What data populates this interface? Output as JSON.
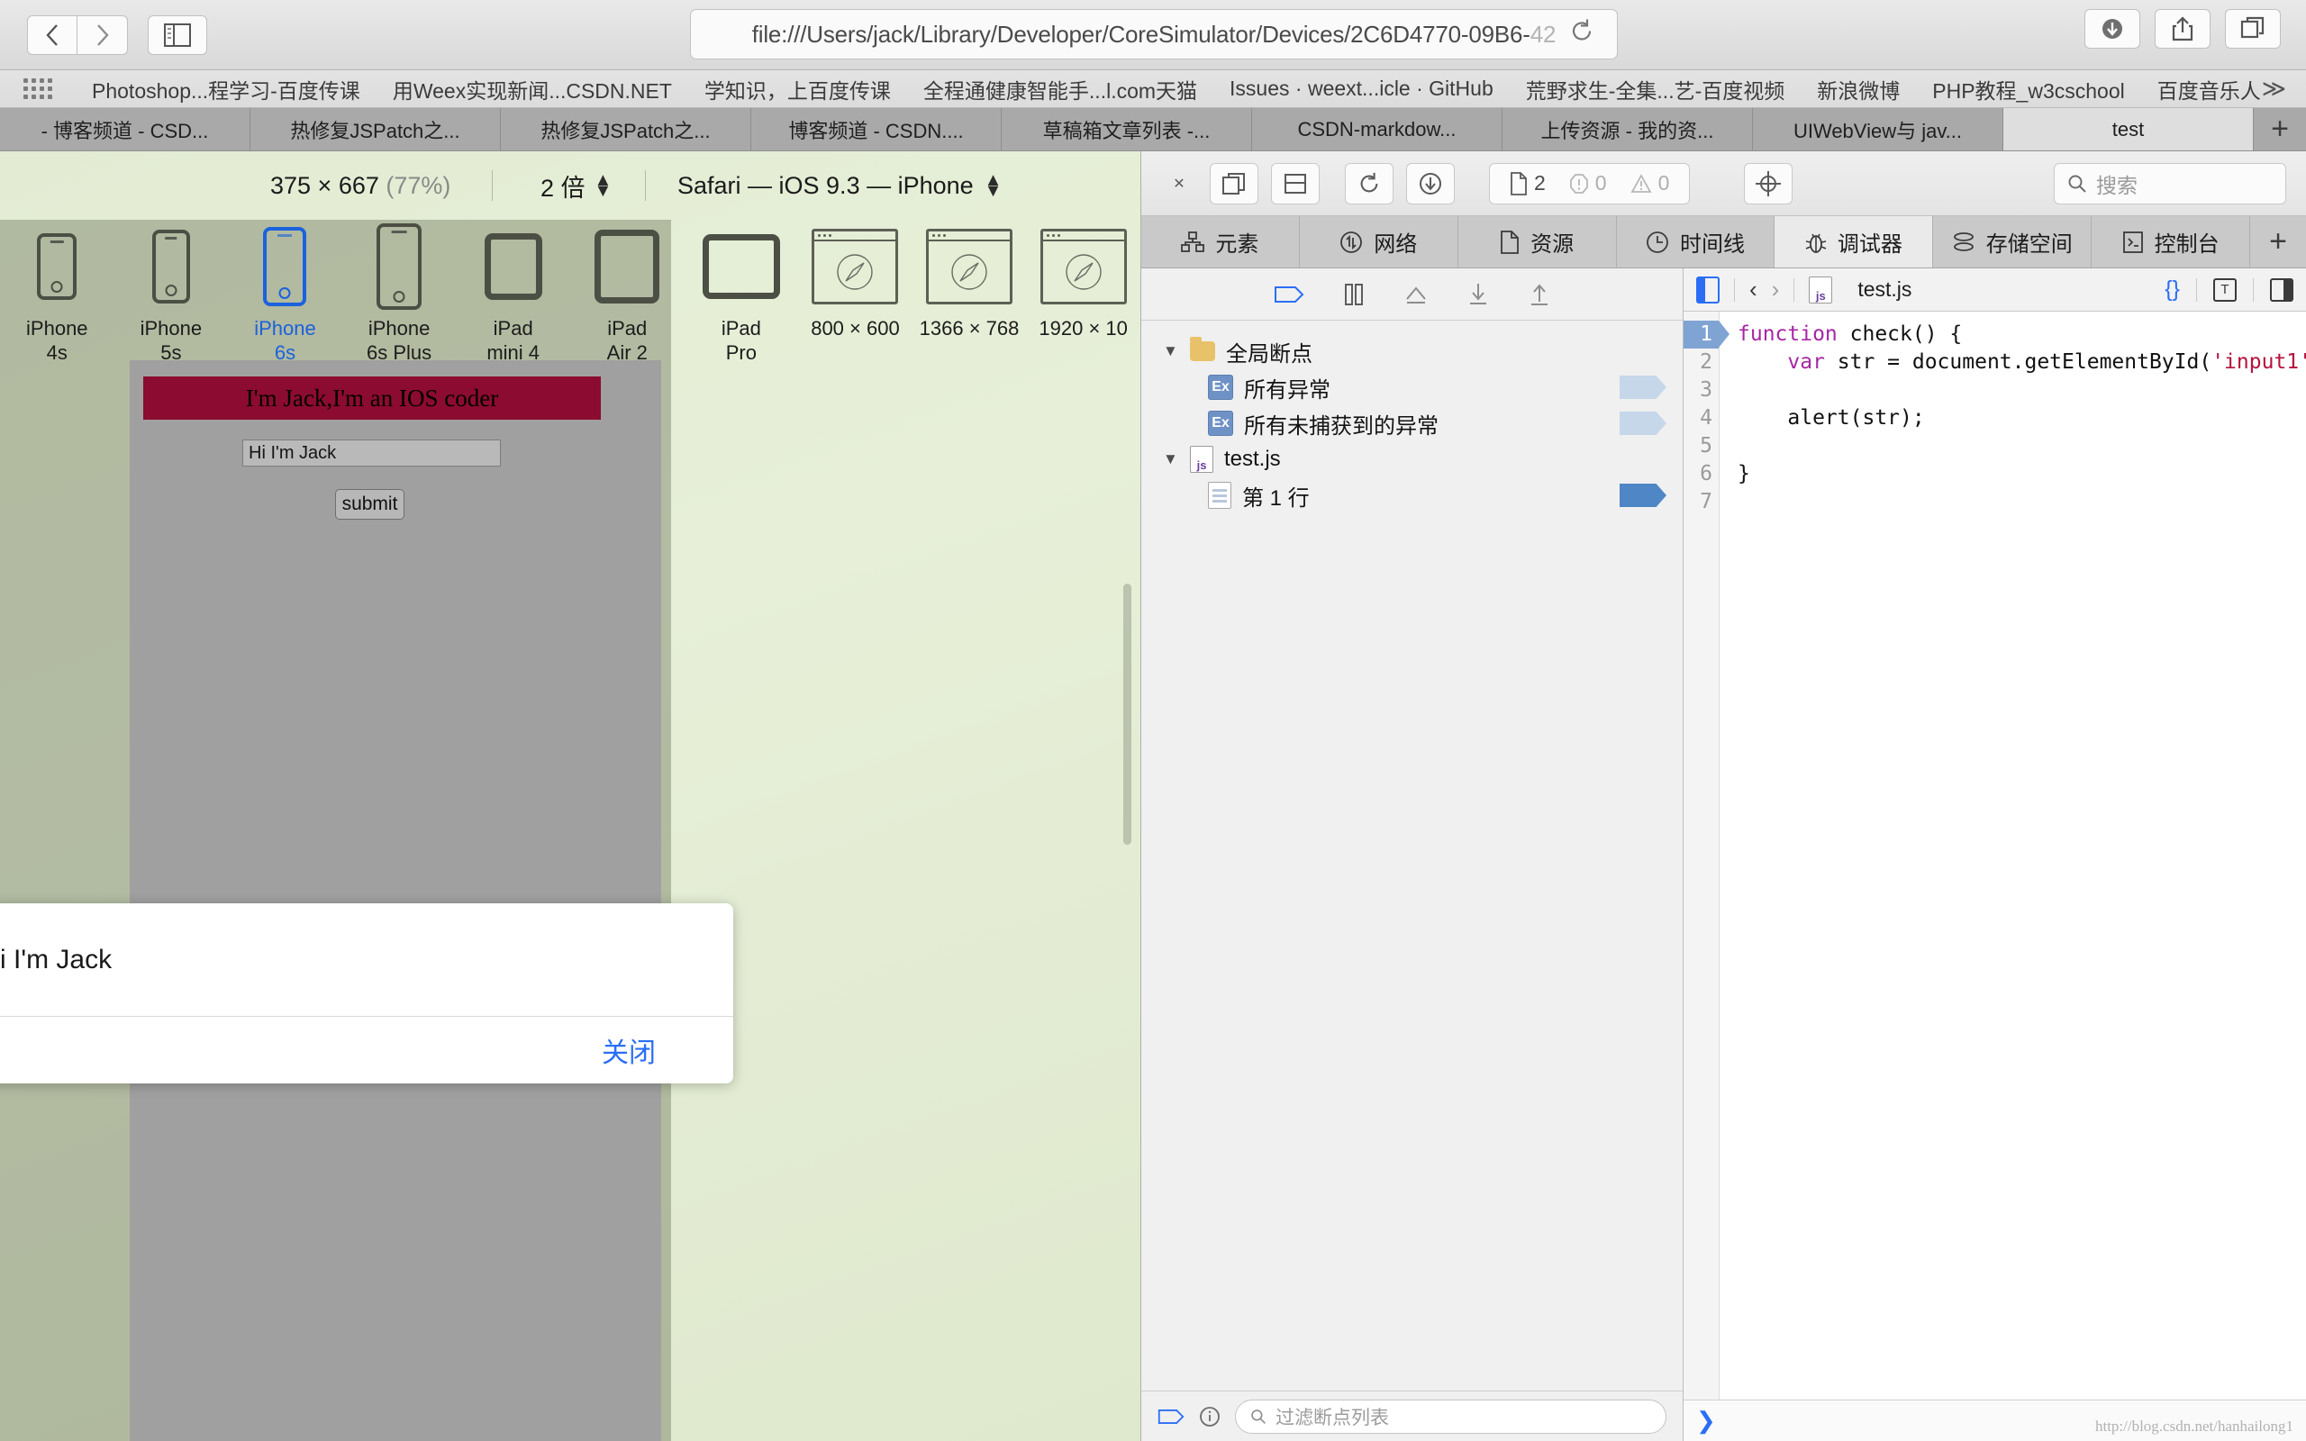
{
  "browser": {
    "back_label": "‹",
    "forward_label": "›",
    "sidebar_icon": "sidebar-icon",
    "url": "file:///Users/jack/Library/Developer/CoreSimulator/Devices/2C6D4770-09B6-",
    "url_dim_tail": "42",
    "reload_icon": "reload-icon",
    "downloads_icon": "downloads-icon",
    "share_icon": "share-icon",
    "tabs_overview_icon": "tabs-overview-icon"
  },
  "bookmarks": {
    "grid_icon": "apps-grid-icon",
    "items": [
      "Photoshop...程学习-百度传课",
      "用Weex实现新闻...CSDN.NET",
      "学知识，上百度传课",
      "全程通健康智能手...l.com天猫",
      "Issues · weext...icle · GitHub",
      "荒野求生-全集...艺-百度视频",
      "新浪微博",
      "PHP教程_w3cschool",
      "百度音乐人"
    ],
    "more_label": "≫"
  },
  "tabs": {
    "items": [
      {
        "label": "- 博客频道 - CSD...",
        "active": false
      },
      {
        "label": "热修复JSPatch之...",
        "active": false
      },
      {
        "label": "热修复JSPatch之...",
        "active": false
      },
      {
        "label": "博客频道 - CSDN....",
        "active": false
      },
      {
        "label": "草稿箱文章列表 -...",
        "active": false
      },
      {
        "label": "CSDN-markdow...",
        "active": false
      },
      {
        "label": "上传资源 - 我的资...",
        "active": false
      },
      {
        "label": "UIWebView与 jav...",
        "active": false
      },
      {
        "label": "test",
        "active": true
      }
    ],
    "add_label": "+"
  },
  "responsive": {
    "dimensions": "375 × 667",
    "zoom_percent": "(77%)",
    "scale": "2 倍",
    "device": "Safari — iOS 9.3 — iPhone",
    "devices": [
      {
        "name": "iPhone",
        "sub": "4s",
        "type": "phone",
        "selected": false
      },
      {
        "name": "iPhone",
        "sub": "5s",
        "type": "phone",
        "selected": false
      },
      {
        "name": "iPhone",
        "sub": "6s",
        "type": "phone",
        "selected": true
      },
      {
        "name": "iPhone",
        "sub": "6s Plus",
        "type": "phone-large",
        "selected": false
      },
      {
        "name": "iPad",
        "sub": "mini 4",
        "type": "tablet",
        "selected": false
      },
      {
        "name": "iPad",
        "sub": "Air 2",
        "type": "tablet-large",
        "selected": false
      },
      {
        "name": "iPad",
        "sub": "Pro",
        "type": "tablet-pro",
        "selected": false
      },
      {
        "name": "800 × 600",
        "sub": "",
        "type": "window",
        "selected": false
      },
      {
        "name": "1366 × 768",
        "sub": "",
        "type": "window",
        "selected": false
      },
      {
        "name": "1920 × 10",
        "sub": "",
        "type": "window",
        "selected": false
      }
    ]
  },
  "webpage": {
    "banner": "I'm Jack,I'm an IOS coder",
    "input_value": "Hi I'm Jack",
    "submit_label": "submit",
    "banner_color": "#8c0b30"
  },
  "alert": {
    "message": "i I'm Jack",
    "close_label": "关闭",
    "accent": "#2b6ef5"
  },
  "inspector": {
    "close_label": "✕",
    "dock_right_icon": "dock-right-icon",
    "dock_bottom_icon": "dock-bottom-icon",
    "reload_icon": "reload-icon",
    "download_icon": "download-icon",
    "resources_count": "2",
    "errors_count": "0",
    "warnings_count": "0",
    "inspect_icon": "inspect-node-icon",
    "search_placeholder": "搜索",
    "tabs": [
      {
        "label": "元素",
        "icon": "elements-icon",
        "active": false
      },
      {
        "label": "网络",
        "icon": "network-icon",
        "active": false
      },
      {
        "label": "资源",
        "icon": "resources-icon",
        "active": false
      },
      {
        "label": "时间线",
        "icon": "timeline-icon",
        "active": false
      },
      {
        "label": "调试器",
        "icon": "debugger-bug-icon",
        "active": true
      },
      {
        "label": "存储空间",
        "icon": "storage-icon",
        "active": false
      },
      {
        "label": "控制台",
        "icon": "console-icon",
        "active": false
      }
    ],
    "tab_add_label": "+"
  },
  "breakpoints": {
    "toolbar_icons": [
      "breakpoint-toggle-icon",
      "pause-icon",
      "step-over-icon",
      "step-into-icon",
      "step-out-icon"
    ],
    "tree": [
      {
        "level": 0,
        "icon": "folder-icon",
        "label": "全局断点",
        "flag": null,
        "twisty": "▼"
      },
      {
        "level": 1,
        "icon": "exception-icon",
        "label": "所有异常",
        "flag": "off",
        "twisty": ""
      },
      {
        "level": 1,
        "icon": "exception-icon",
        "label": "所有未捕获到的异常",
        "flag": "off",
        "twisty": ""
      },
      {
        "level": 0,
        "icon": "js-file-icon",
        "label": "test.js",
        "flag": null,
        "twisty": "▼"
      },
      {
        "level": 1,
        "icon": "line-icon",
        "label": "第 1 行",
        "flag": "on",
        "twisty": ""
      }
    ],
    "filter_placeholder": "过滤断点列表",
    "footer_icons": [
      "breakpoint-toggle-icon",
      "info-icon"
    ]
  },
  "code": {
    "back_label": "‹",
    "forward_label": "›",
    "filename": "test.js",
    "file_icon": "js-file-icon",
    "sidebar_toggle_icon": "panel-toggle-icon",
    "pretty_print_label": "{}",
    "type_icon": "show-types-icon",
    "split_icon": "split-panel-icon",
    "lines": [
      {
        "n": "1",
        "current": true,
        "tokens": [
          {
            "t": "function ",
            "c": "k"
          },
          {
            "t": "check() {",
            "c": "p"
          }
        ]
      },
      {
        "n": "2",
        "current": false,
        "tokens": [
          {
            "t": "    ",
            "c": "p"
          },
          {
            "t": "var ",
            "c": "k"
          },
          {
            "t": "str = document.getElementById(",
            "c": "p"
          },
          {
            "t": "'input1'",
            "c": "s"
          },
          {
            "t": ")",
            "c": "p"
          }
        ]
      },
      {
        "n": "3",
        "current": false,
        "tokens": []
      },
      {
        "n": "4",
        "current": false,
        "tokens": [
          {
            "t": "    alert(str);",
            "c": "p"
          }
        ]
      },
      {
        "n": "5",
        "current": false,
        "tokens": []
      },
      {
        "n": "6",
        "current": false,
        "tokens": [
          {
            "t": "}",
            "c": "p"
          }
        ]
      },
      {
        "n": "7",
        "current": false,
        "tokens": []
      }
    ],
    "console_prompt": "❯"
  },
  "watermark": "http://blog.csdn.net/hanhailong1"
}
